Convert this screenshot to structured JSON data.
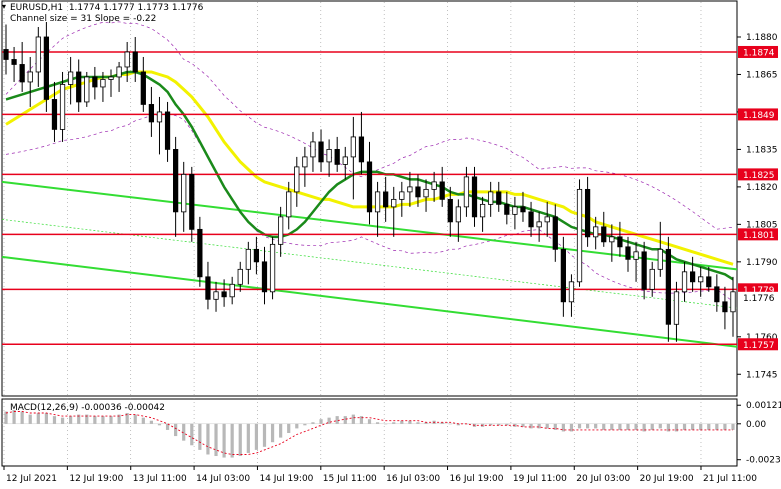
{
  "header": {
    "symbol_line": "EURUSD,H1  1.1774 1.1777 1.1773 1.1776",
    "channel_line": "Channel size = 31 Slope = -0.22",
    "macd_label": "MACD(12,26,9) -0.00036 -0.00042"
  },
  "colors": {
    "background": "#ffffff",
    "candles": "#000000",
    "hline": "#e8001c",
    "price_tag_bg": "#e8001c",
    "price_tag_text": "#ffffff",
    "ma_fast": "#1a8a1a",
    "ma_slow": "#f2f200",
    "trend": "#33dd33",
    "bands": "#9c27b0",
    "macd_hist": "#b8b8b8",
    "macd_signal": "#e8001c"
  },
  "chart_data": {
    "type": "candlestick",
    "symbol": "EURUSD",
    "timeframe": "H1",
    "y_ticks": [
      "1.1880",
      "1.1865",
      "1.1850",
      "1.1835",
      "1.1820",
      "1.1805",
      "1.1790",
      "1.1760",
      "1.1745"
    ],
    "x_ticks": [
      "12 Jul 2021",
      "12 Jul 19:00",
      "13 Jul 11:00",
      "14 Jul 03:00",
      "14 Jul 19:00",
      "15 Jul 11:00",
      "16 Jul 03:00",
      "16 Jul 19:00",
      "19 Jul 11:00",
      "20 Jul 03:00",
      "20 Jul 19:00",
      "21 Jul 11:00"
    ],
    "levels": [
      {
        "label": "1.1874",
        "value": 1.1874
      },
      {
        "label": "1.1849",
        "value": 1.1849
      },
      {
        "label": "1.1825",
        "value": 1.1825
      },
      {
        "label": "1.1801",
        "value": 1.1801
      },
      {
        "label": "1.1779",
        "value": 1.1779
      },
      {
        "label": "1.1757",
        "value": 1.1757
      }
    ],
    "current_price": {
      "label": "1.1776",
      "value": 1.1776
    },
    "ohlc": [
      [
        1.1875,
        1.1885,
        1.1865,
        1.1871
      ],
      [
        1.1871,
        1.1876,
        1.1862,
        1.1869
      ],
      [
        1.1869,
        1.1878,
        1.1858,
        1.1862
      ],
      [
        1.1862,
        1.1872,
        1.1852,
        1.1866
      ],
      [
        1.1866,
        1.1884,
        1.186,
        1.188
      ],
      [
        1.188,
        1.1886,
        1.185,
        1.1855
      ],
      [
        1.1855,
        1.1862,
        1.1838,
        1.1843
      ],
      [
        1.1843,
        1.1866,
        1.1838,
        1.1861
      ],
      [
        1.1861,
        1.1872,
        1.1853,
        1.1866
      ],
      [
        1.1866,
        1.1871,
        1.185,
        1.1854
      ],
      [
        1.1854,
        1.1866,
        1.1852,
        1.1864
      ],
      [
        1.1864,
        1.1868,
        1.1855,
        1.186
      ],
      [
        1.186,
        1.1866,
        1.1854,
        1.1863
      ],
      [
        1.1863,
        1.1867,
        1.1856,
        1.1864
      ],
      [
        1.1864,
        1.187,
        1.1858,
        1.1868
      ],
      [
        1.1868,
        1.1878,
        1.1862,
        1.1874
      ],
      [
        1.1874,
        1.188,
        1.1862,
        1.1866
      ],
      [
        1.1866,
        1.1872,
        1.185,
        1.1853
      ],
      [
        1.1853,
        1.186,
        1.184,
        1.1846
      ],
      [
        1.1846,
        1.1856,
        1.1833,
        1.185
      ],
      [
        1.185,
        1.1854,
        1.183,
        1.1835
      ],
      [
        1.1835,
        1.184,
        1.18,
        1.181
      ],
      [
        1.181,
        1.183,
        1.1802,
        1.1825
      ],
      [
        1.1825,
        1.1828,
        1.1798,
        1.1803
      ],
      [
        1.1803,
        1.1808,
        1.178,
        1.1784
      ],
      [
        1.1784,
        1.179,
        1.1771,
        1.1775
      ],
      [
        1.1775,
        1.1782,
        1.177,
        1.1778
      ],
      [
        1.1778,
        1.1783,
        1.1772,
        1.1776
      ],
      [
        1.1776,
        1.1784,
        1.1773,
        1.1781
      ],
      [
        1.1781,
        1.179,
        1.1778,
        1.1787
      ],
      [
        1.1787,
        1.1798,
        1.1781,
        1.1795
      ],
      [
        1.1795,
        1.18,
        1.1785,
        1.179
      ],
      [
        1.179,
        1.1796,
        1.1773,
        1.1778
      ],
      [
        1.1778,
        1.18,
        1.1775,
        1.1797
      ],
      [
        1.1797,
        1.1812,
        1.1792,
        1.1808
      ],
      [
        1.1808,
        1.1822,
        1.1803,
        1.1818
      ],
      [
        1.1818,
        1.1832,
        1.1812,
        1.1828
      ],
      [
        1.1828,
        1.1836,
        1.182,
        1.1832
      ],
      [
        1.1832,
        1.1842,
        1.1826,
        1.1838
      ],
      [
        1.1838,
        1.1843,
        1.1826,
        1.183
      ],
      [
        1.183,
        1.1839,
        1.1824,
        1.1835
      ],
      [
        1.1835,
        1.184,
        1.1826,
        1.1829
      ],
      [
        1.1829,
        1.1836,
        1.1823,
        1.1832
      ],
      [
        1.1832,
        1.1848,
        1.1815,
        1.184
      ],
      [
        1.184,
        1.185,
        1.1825,
        1.183
      ],
      [
        1.183,
        1.1838,
        1.1805,
        1.181
      ],
      [
        1.181,
        1.1822,
        1.18,
        1.1818
      ],
      [
        1.1818,
        1.1824,
        1.1806,
        1.1812
      ],
      [
        1.1812,
        1.182,
        1.18,
        1.1815
      ],
      [
        1.1815,
        1.1822,
        1.1808,
        1.1818
      ],
      [
        1.1818,
        1.1826,
        1.1812,
        1.182
      ],
      [
        1.182,
        1.1825,
        1.1812,
        1.1816
      ],
      [
        1.1816,
        1.1823,
        1.181,
        1.1819
      ],
      [
        1.1819,
        1.1826,
        1.1814,
        1.1822
      ],
      [
        1.1822,
        1.1828,
        1.1812,
        1.1815
      ],
      [
        1.1815,
        1.182,
        1.18,
        1.1806
      ],
      [
        1.1806,
        1.1815,
        1.1798,
        1.1812
      ],
      [
        1.1812,
        1.1828,
        1.1808,
        1.1824
      ],
      [
        1.1824,
        1.1828,
        1.1804,
        1.1808
      ],
      [
        1.1808,
        1.1816,
        1.1802,
        1.1813
      ],
      [
        1.1813,
        1.1822,
        1.1808,
        1.1818
      ],
      [
        1.1818,
        1.1822,
        1.181,
        1.1813
      ],
      [
        1.1813,
        1.1818,
        1.1805,
        1.1809
      ],
      [
        1.1809,
        1.1816,
        1.1803,
        1.1812
      ],
      [
        1.1812,
        1.1818,
        1.1806,
        1.181
      ],
      [
        1.181,
        1.1814,
        1.18,
        1.1804
      ],
      [
        1.1804,
        1.181,
        1.1798,
        1.1806
      ],
      [
        1.1806,
        1.1814,
        1.18,
        1.1808
      ],
      [
        1.1808,
        1.1813,
        1.179,
        1.1795
      ],
      [
        1.1795,
        1.18,
        1.1768,
        1.1774
      ],
      [
        1.1774,
        1.1785,
        1.1768,
        1.1782
      ],
      [
        1.1782,
        1.1823,
        1.178,
        1.1819
      ],
      [
        1.1819,
        1.1824,
        1.1796,
        1.18
      ],
      [
        1.18,
        1.1808,
        1.1795,
        1.1804
      ],
      [
        1.1804,
        1.181,
        1.1796,
        1.1798
      ],
      [
        1.1798,
        1.1805,
        1.179,
        1.18
      ],
      [
        1.18,
        1.1806,
        1.1792,
        1.1796
      ],
      [
        1.1796,
        1.18,
        1.1786,
        1.1791
      ],
      [
        1.1791,
        1.1798,
        1.1782,
        1.1794
      ],
      [
        1.1794,
        1.1798,
        1.1775,
        1.1779
      ],
      [
        1.1779,
        1.179,
        1.1776,
        1.1787
      ],
      [
        1.1787,
        1.1806,
        1.1784,
        1.1795
      ],
      [
        1.1795,
        1.18,
        1.1758,
        1.1765
      ],
      [
        1.1765,
        1.1782,
        1.1758,
        1.1778
      ],
      [
        1.1778,
        1.179,
        1.1774,
        1.1786
      ],
      [
        1.1786,
        1.1792,
        1.1778,
        1.1782
      ],
      [
        1.1782,
        1.1788,
        1.1776,
        1.1784
      ],
      [
        1.1784,
        1.1788,
        1.1778,
        1.178
      ],
      [
        1.178,
        1.1785,
        1.177,
        1.1774
      ],
      [
        1.1774,
        1.178,
        1.1763,
        1.177
      ],
      [
        1.177,
        1.1784,
        1.176,
        1.1778
      ]
    ],
    "ma_fast": [
      1.1855,
      1.1856,
      1.1857,
      1.1858,
      1.1859,
      1.186,
      1.1861,
      1.1862,
      1.1863,
      1.1864,
      1.1864,
      1.1864,
      1.1864,
      1.1864,
      1.1865,
      1.1866,
      1.1866,
      1.1865,
      1.1863,
      1.1861,
      1.1858,
      1.1853,
      1.1849,
      1.1844,
      1.1838,
      1.1832,
      1.1826,
      1.182,
      1.1815,
      1.181,
      1.1806,
      1.1803,
      1.1801,
      1.18,
      1.18,
      1.1801,
      1.1803,
      1.1806,
      1.181,
      1.1814,
      1.1818,
      1.1821,
      1.1823,
      1.1825,
      1.1826,
      1.1826,
      1.1826,
      1.1825,
      1.1825,
      1.1824,
      1.1823,
      1.1823,
      1.1822,
      1.1821,
      1.182,
      1.1818,
      1.1817,
      1.1817,
      1.1816,
      1.1815,
      1.1814,
      1.1814,
      1.1813,
      1.1812,
      1.1812,
      1.1811,
      1.181,
      1.1809,
      1.1808,
      1.1806,
      1.1804,
      1.1803,
      1.1802,
      1.1801,
      1.1801,
      1.18,
      1.1799,
      1.1798,
      1.1797,
      1.1796,
      1.1795,
      1.1795,
      1.1793,
      1.1791,
      1.179,
      1.1789,
      1.1788,
      1.1787,
      1.1786,
      1.1785,
      1.1783
    ],
    "ma_slow": [
      1.1845,
      1.1847,
      1.1849,
      1.1851,
      1.1853,
      1.1855,
      1.1857,
      1.1859,
      1.186,
      1.1861,
      1.1862,
      1.1863,
      1.1864,
      1.1864,
      1.1865,
      1.1865,
      1.1866,
      1.1866,
      1.1866,
      1.1865,
      1.1864,
      1.1862,
      1.1859,
      1.1856,
      1.1852,
      1.1848,
      1.1843,
      1.1838,
      1.1834,
      1.183,
      1.1827,
      1.1824,
      1.1822,
      1.1821,
      1.182,
      1.1819,
      1.1818,
      1.1817,
      1.1816,
      1.1815,
      1.1815,
      1.1814,
      1.1813,
      1.1812,
      1.1812,
      1.1812,
      1.1812,
      1.1812,
      1.1812,
      1.1813,
      1.1813,
      1.1814,
      1.1815,
      1.1815,
      1.1816,
      1.1817,
      1.1817,
      1.1818,
      1.1818,
      1.1818,
      1.1818,
      1.1818,
      1.1818,
      1.1817,
      1.1817,
      1.1816,
      1.1815,
      1.1814,
      1.1813,
      1.1812,
      1.181,
      1.1809,
      1.1808,
      1.1806,
      1.1805,
      1.1804,
      1.1803,
      1.1802,
      1.1801,
      1.18,
      1.1799,
      1.1798,
      1.1797,
      1.1796,
      1.1795,
      1.1794,
      1.1793,
      1.1792,
      1.1791,
      1.179,
      1.1789
    ],
    "trendlines": [
      {
        "from": [
          0,
          1.1822
        ],
        "to": [
          92,
          1.1787
        ]
      },
      {
        "from": [
          0,
          1.1792
        ],
        "to": [
          92,
          1.1756
        ]
      }
    ],
    "macd": {
      "y_ticks": [
        "0.00121",
        "0.00",
        "-0.00234"
      ],
      "histogram": [
        0.0008,
        0.0009,
        0.0008,
        0.0006,
        0.0007,
        0.0007,
        0.0005,
        0.0004,
        0.0005,
        0.0006,
        0.0006,
        0.0005,
        0.0005,
        0.0005,
        0.0006,
        0.0007,
        0.0006,
        0.0004,
        0.0002,
        -0.0001,
        -0.0004,
        -0.0008,
        -0.0011,
        -0.0014,
        -0.0017,
        -0.002,
        -0.0021,
        -0.0022,
        -0.0022,
        -0.0021,
        -0.0019,
        -0.0017,
        -0.0015,
        -0.0012,
        -0.0009,
        -0.0006,
        -0.0003,
        -0.0001,
        0.0001,
        0.0003,
        0.0004,
        0.0005,
        0.0005,
        0.0006,
        0.0005,
        0.0003,
        0.0001,
        0.0,
        0.0001,
        0.0002,
        0.0002,
        0.0001,
        0.0001,
        0.0002,
        0.0001,
        0.0,
        -0.0001,
        0.0,
        -0.0002,
        -0.0002,
        -0.0001,
        -0.0001,
        -0.0001,
        -0.0002,
        -0.0002,
        -0.0003,
        -0.0003,
        -0.0003,
        -0.0004,
        -0.0005,
        -0.0005,
        -0.0003,
        -0.0003,
        -0.0003,
        -0.0004,
        -0.0004,
        -0.0004,
        -0.0004,
        -0.0004,
        -0.0005,
        -0.0004,
        -0.0003,
        -0.0005,
        -0.0005,
        -0.0004,
        -0.0004,
        -0.0004,
        -0.0004,
        -0.0004,
        -0.0004,
        -0.0004
      ],
      "signal": [
        0.0007,
        0.0008,
        0.0008,
        0.0007,
        0.0007,
        0.0007,
        0.0006,
        0.0005,
        0.0005,
        0.0005,
        0.0005,
        0.0005,
        0.0005,
        0.0005,
        0.0005,
        0.0006,
        0.0006,
        0.0005,
        0.0004,
        0.0002,
        0.0,
        -0.0003,
        -0.0006,
        -0.0009,
        -0.0012,
        -0.0015,
        -0.0017,
        -0.0019,
        -0.002,
        -0.002,
        -0.002,
        -0.0019,
        -0.0017,
        -0.0015,
        -0.0013,
        -0.001,
        -0.0007,
        -0.0005,
        -0.0003,
        -0.0001,
        0.0001,
        0.0002,
        0.0003,
        0.0004,
        0.0004,
        0.0004,
        0.0003,
        0.0002,
        0.0002,
        0.0002,
        0.0002,
        0.0002,
        0.0001,
        0.0001,
        0.0001,
        0.0001,
        0.0,
        0.0,
        -0.0001,
        -0.0001,
        -0.0001,
        -0.0001,
        -0.0001,
        -0.0001,
        -0.0002,
        -0.0002,
        -0.0002,
        -0.0003,
        -0.0003,
        -0.0004,
        -0.0004,
        -0.0004,
        -0.0004,
        -0.0004,
        -0.0004,
        -0.0004,
        -0.0004,
        -0.0004,
        -0.0004,
        -0.0004,
        -0.0004,
        -0.0004,
        -0.0004,
        -0.0004,
        -0.0004,
        -0.0004,
        -0.0004,
        -0.0004,
        -0.0004,
        -0.0004,
        -0.0004
      ]
    }
  }
}
